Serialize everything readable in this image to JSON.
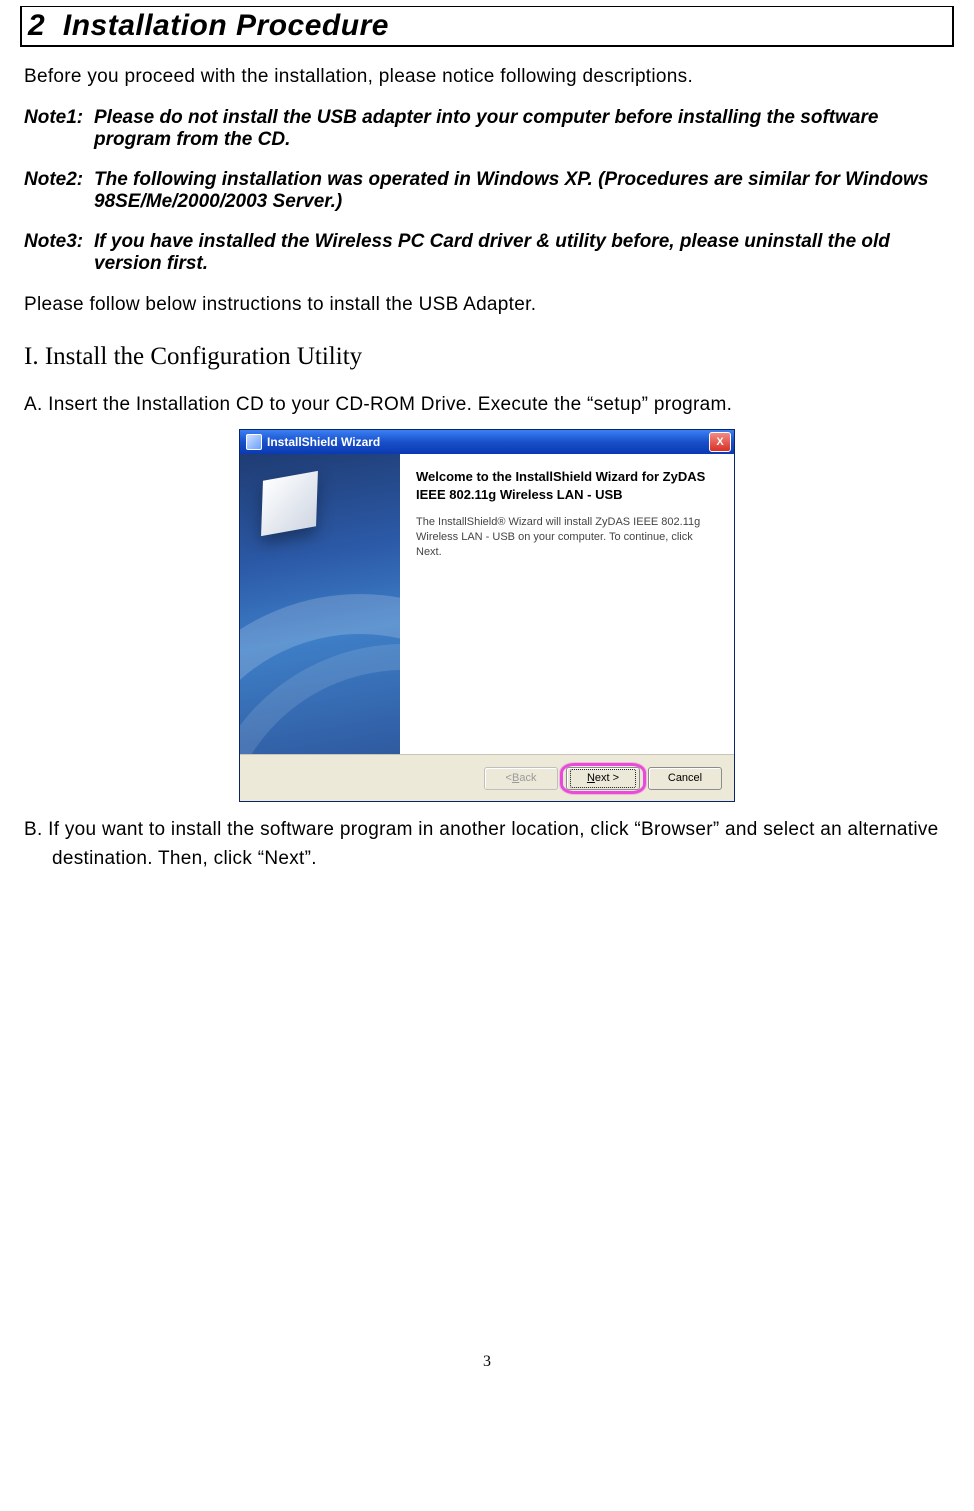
{
  "section": {
    "number": "2",
    "title": "Installation Procedure"
  },
  "intro": "Before you proceed with the installation, please notice following descriptions.",
  "notes": [
    {
      "label": "Note1:",
      "body": "Please do not install the USB adapter into your computer before installing the software program from the CD."
    },
    {
      "label": "Note2:",
      "body": "The following installation was operated in Windows XP.  (Procedures are similar for Windows 98SE/Me/2000/2003 Server.)"
    },
    {
      "label": "Note3:",
      "body": "If you have installed the Wireless PC Card driver & utility before, please uninstall the old version first."
    }
  ],
  "follow": "Please follow below instructions to install the USB Adapter.",
  "subhead": "I. Install the Configuration Utility",
  "steps": {
    "a": "A. Insert the Installation CD to your CD-ROM Drive. Execute the “setup” program.",
    "b": "B. If you want to install the software program in another location, click “Browser” and select an alternative destination. Then, click “Next”."
  },
  "wizard": {
    "title": "InstallShield Wizard",
    "close_glyph": "X",
    "heading": "Welcome to the InstallShield Wizard for ZyDAS IEEE 802.11g Wireless LAN - USB",
    "desc": "The InstallShield® Wizard will install ZyDAS IEEE 802.11g Wireless LAN - USB on your computer.  To continue, click Next.",
    "buttons": {
      "back_prefix": "< ",
      "back_u": "B",
      "back_suffix": "ack",
      "next_u": "N",
      "next_suffix": "ext >",
      "cancel": "Cancel"
    }
  },
  "page_number": "3"
}
